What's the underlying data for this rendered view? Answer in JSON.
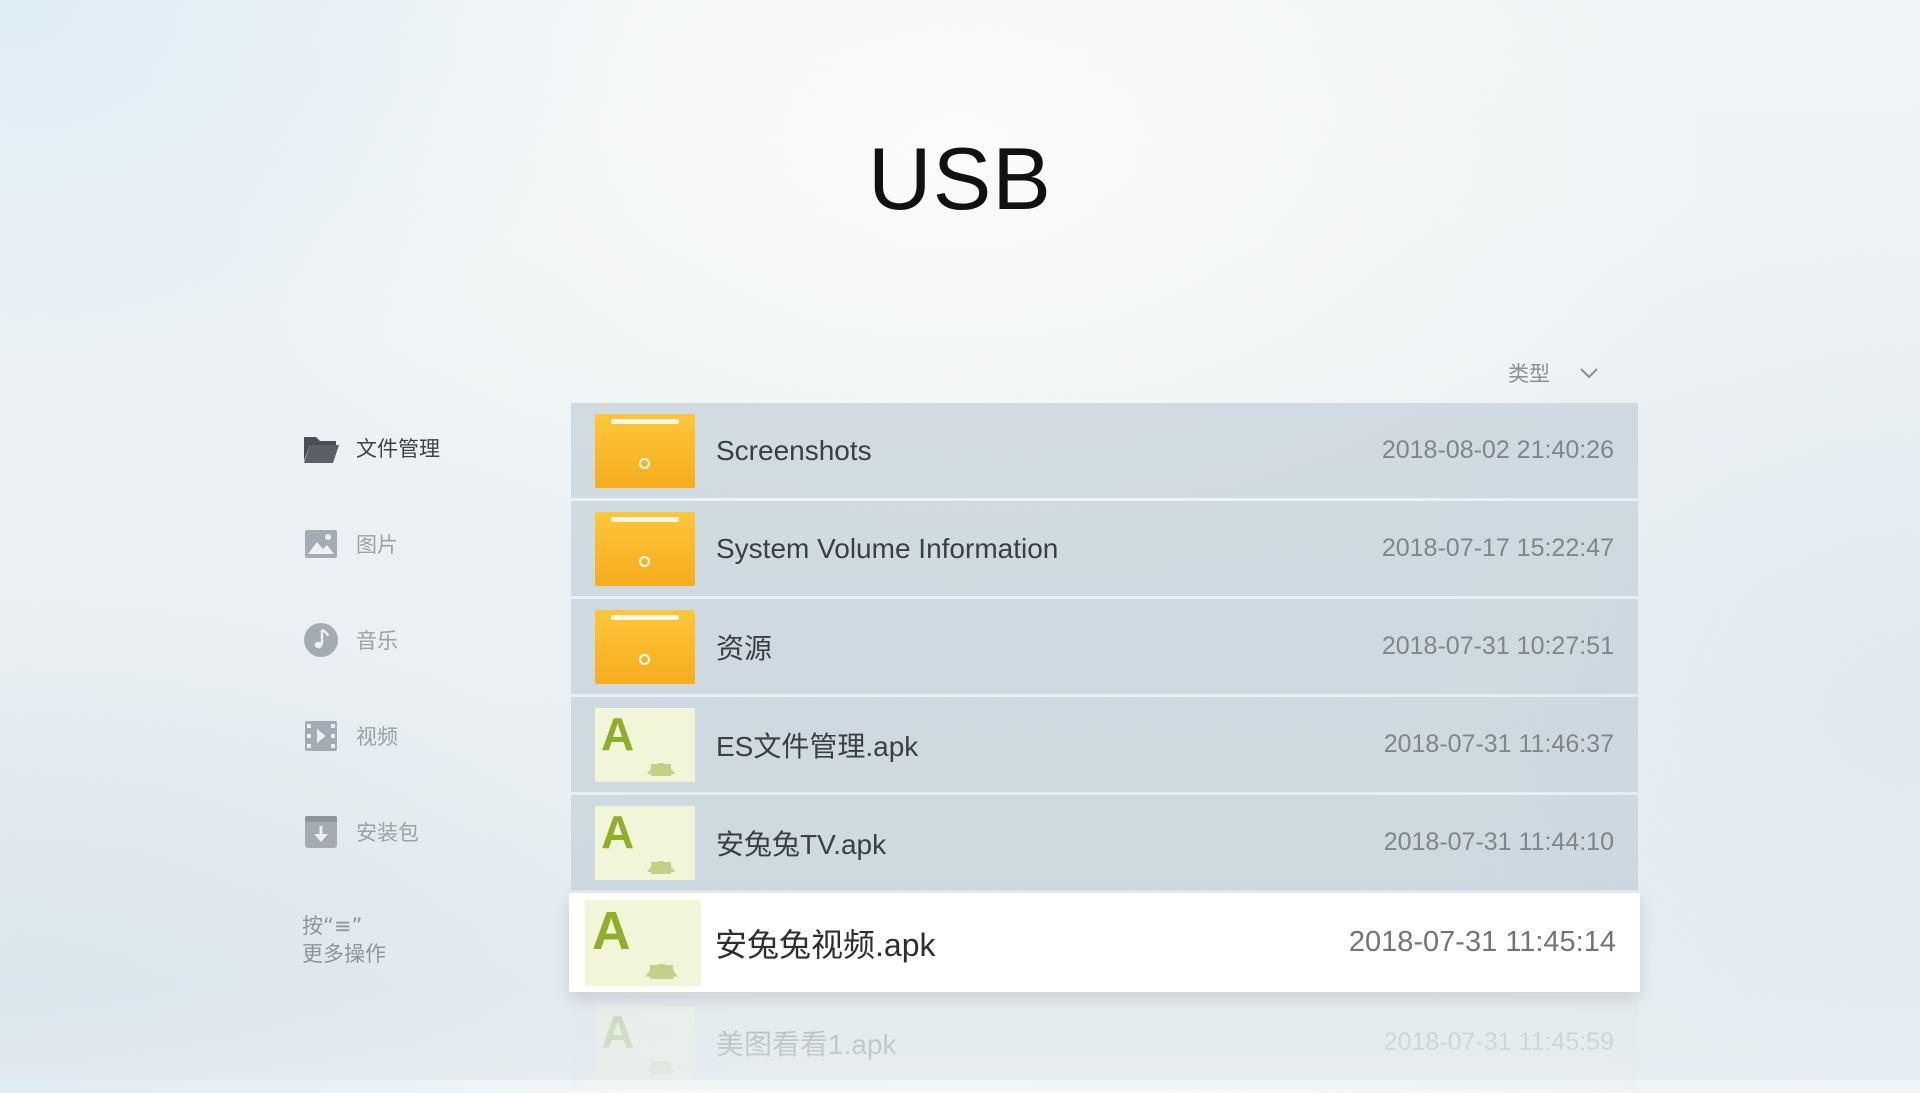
{
  "header": {
    "title": "USB"
  },
  "sort": {
    "label": "类型",
    "icon": "chevron-down-icon"
  },
  "sidebar": {
    "items": [
      {
        "label": "文件管理",
        "icon": "folder-icon",
        "active": true
      },
      {
        "label": "图片",
        "icon": "image-icon",
        "active": false
      },
      {
        "label": "音乐",
        "icon": "music-icon",
        "active": false
      },
      {
        "label": "视频",
        "icon": "video-icon",
        "active": false
      },
      {
        "label": "安装包",
        "icon": "package-icon",
        "active": false
      }
    ],
    "hint_line1": "按“≡”",
    "hint_line2": "更多操作"
  },
  "files": [
    {
      "name": "Screenshots",
      "date": "2018-08-02 21:40:26",
      "type": "folder"
    },
    {
      "name": "System Volume Information",
      "date": "2018-07-17 15:22:47",
      "type": "folder"
    },
    {
      "name": "资源",
      "date": "2018-07-31 10:27:51",
      "type": "folder"
    },
    {
      "name": "ES文件管理.apk",
      "date": "2018-07-31 11:46:37",
      "type": "apk"
    },
    {
      "name": "安兔兔TV.apk",
      "date": "2018-07-31 11:44:10",
      "type": "apk"
    },
    {
      "name": "安兔兔视频.apk",
      "date": "2018-07-31 11:45:14",
      "type": "apk",
      "focused": true
    },
    {
      "name": "美图看看1.apk",
      "date": "2018-07-31 11:45:59",
      "type": "apk"
    }
  ],
  "colors": {
    "folder": "#f6ad1c",
    "apk_letter": "#8fae2a",
    "row_bg": "#bfcbd5",
    "focus_bg": "#ffffff"
  }
}
